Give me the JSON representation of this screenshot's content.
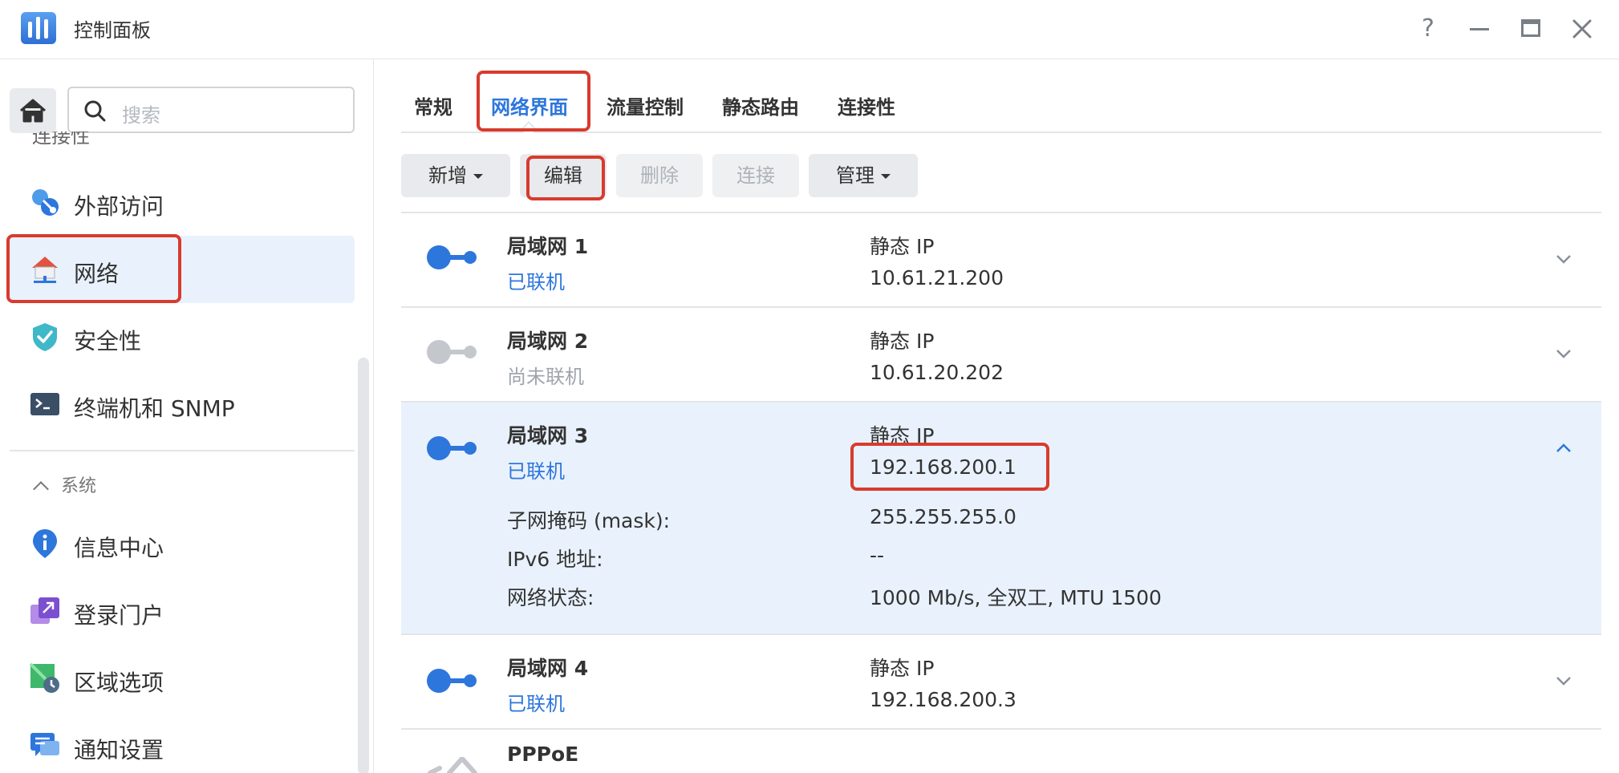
{
  "window": {
    "title": "控制面板",
    "help": "?"
  },
  "sidebar": {
    "search_placeholder": "搜索",
    "cut_item": "连接性",
    "items": [
      {
        "label": "外部访问",
        "icon": "external-access-icon"
      },
      {
        "label": "网络",
        "icon": "network-icon",
        "active": true
      },
      {
        "label": "安全性",
        "icon": "shield-icon"
      },
      {
        "label": "终端机和 SNMP",
        "icon": "terminal-icon"
      }
    ],
    "section_system": "系统",
    "system_items": [
      {
        "label": "信息中心",
        "icon": "info-icon"
      },
      {
        "label": "登录门户",
        "icon": "login-portal-icon"
      },
      {
        "label": "区域选项",
        "icon": "region-icon"
      },
      {
        "label": "通知设置",
        "icon": "notification-icon"
      }
    ]
  },
  "tabs": [
    "常规",
    "网络界面",
    "流量控制",
    "静态路由",
    "连接性"
  ],
  "active_tab": "网络界面",
  "toolbar": {
    "add": "新增",
    "edit": "编辑",
    "delete": "删除",
    "connect": "连接",
    "manage": "管理"
  },
  "interfaces": [
    {
      "name": "局域网 1",
      "status": "已联机",
      "type": "静态 IP",
      "ip": "10.61.21.200",
      "connected": true
    },
    {
      "name": "局域网 2",
      "status": "尚未联机",
      "type": "静态 IP",
      "ip": "10.61.20.202",
      "connected": false
    },
    {
      "name": "局域网 3",
      "status": "已联机",
      "type": "静态 IP",
      "ip": "192.168.200.1",
      "connected": true,
      "expanded": true,
      "details": [
        {
          "label": "子网掩码 (mask):",
          "value": "255.255.255.0"
        },
        {
          "label": "IPv6 地址:",
          "value": "--"
        },
        {
          "label": "网络状态:",
          "value": "1000 Mb/s, 全双工, MTU 1500"
        }
      ]
    },
    {
      "name": "局域网 4",
      "status": "已联机",
      "type": "静态 IP",
      "ip": "192.168.200.3",
      "connected": true
    },
    {
      "name": "PPPoE"
    }
  ],
  "colors": {
    "accent": "#2d76dc",
    "connected": "#2d76dc",
    "disconnected": "#c4c7cc",
    "highlight": "#d83b2e",
    "active_bg": "#e9f1fc"
  }
}
